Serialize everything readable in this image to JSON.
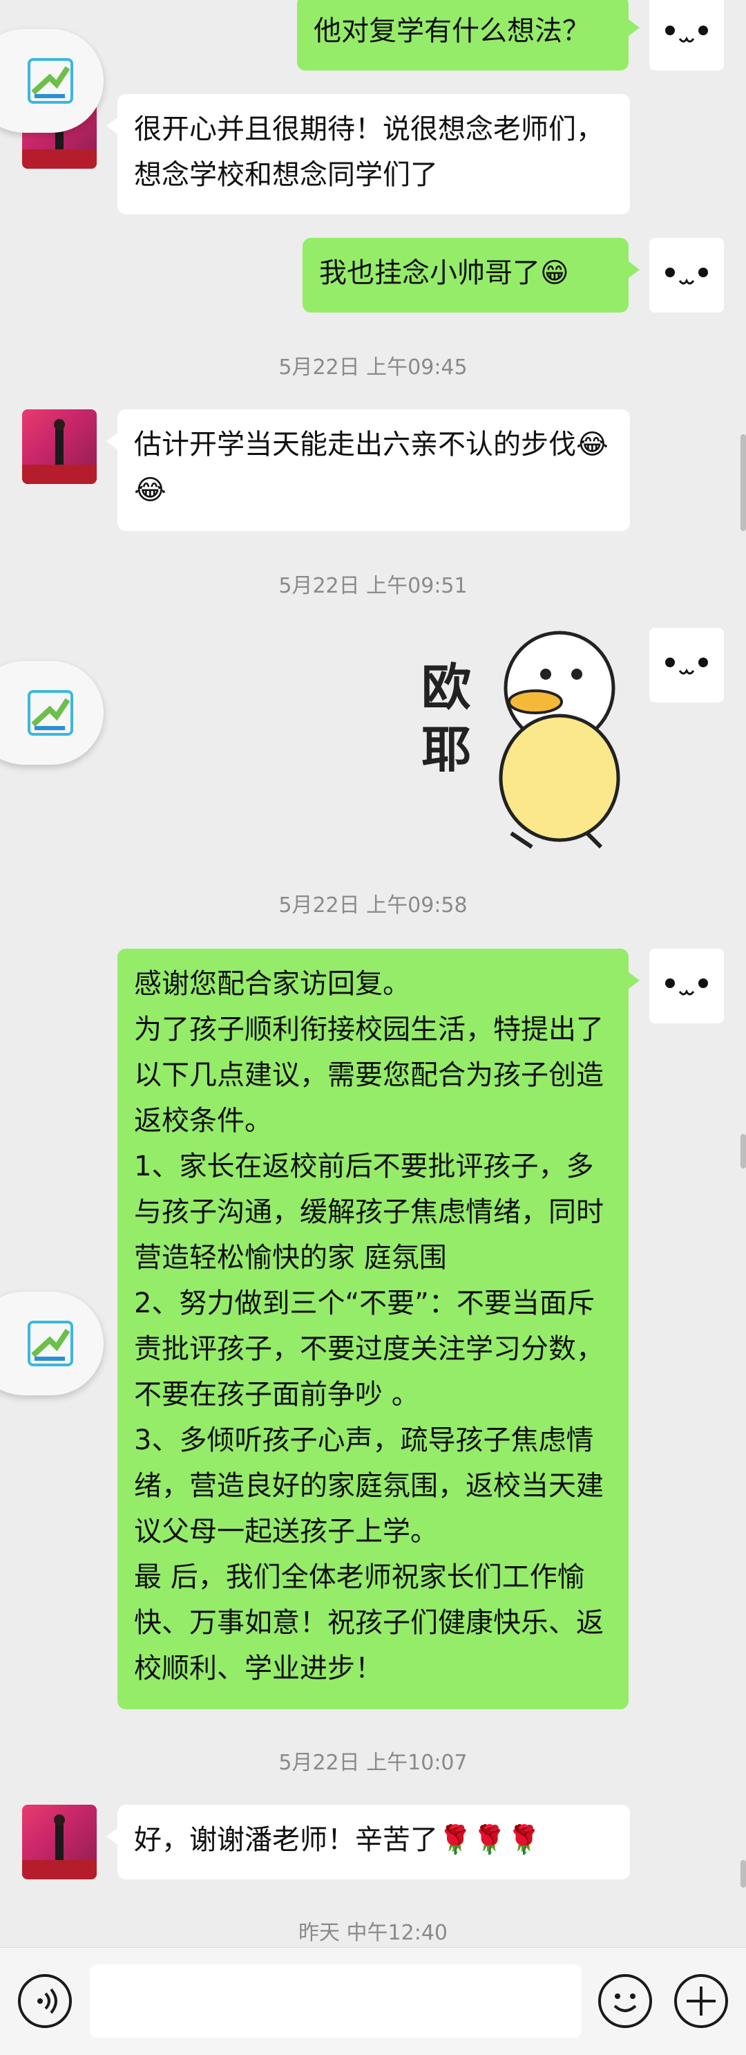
{
  "messages": {
    "m1": "他对复学有什么想法？",
    "m2": "很开心并且很期待！说很想念老师们，想念学校和想念同学们了",
    "m3": "我也挂念小帅哥了😁",
    "t1": "5月22日 上午09:45",
    "m4": "估计开学当天能走出六亲不认的步伐😂😂",
    "t2": "5月22日 上午09:51",
    "sticker_line1": "欧",
    "sticker_line2": "耶",
    "t3": "5月22日 上午09:58",
    "m5": "感谢您配合家访回复。\n为了孩子顺利衔接校园生活，特提出了以下几点建议，需要您配合为孩子创造 返校条件。\n1、家长在返校前后不要批评孩子，多与孩子沟通，缓解孩子焦虑情绪，同时营造轻松愉快的家 庭氛围\n2、努力做到三个“不要”：不要当面斥责批评孩子，不要过度关注学习分数，不要在孩子面前争吵 。\n3、多倾听孩子心声，疏导孩子焦虑情绪，营造良好的家庭氛围，返校当天建议父母一起送孩子上学。\n最 后，我们全体老师祝家长们工作愉快、万事如意！祝孩子们健康快乐、返校顺利、学业进步！",
    "t4": "5月22日 上午10:07",
    "m6": "好，谢谢潘老师！辛苦了🌹🌹🌹",
    "t5": "昨天 中午12:40"
  },
  "avatars": {
    "self_face": "•ᴗ•"
  },
  "icons": {
    "voice": "voice-icon",
    "emoji": "emoji-icon",
    "plus": "plus-icon",
    "floating": "app-logo-icon"
  },
  "colors": {
    "outgoing_bubble": "#95ec69",
    "incoming_bubble": "#ffffff",
    "background": "#ededed"
  }
}
